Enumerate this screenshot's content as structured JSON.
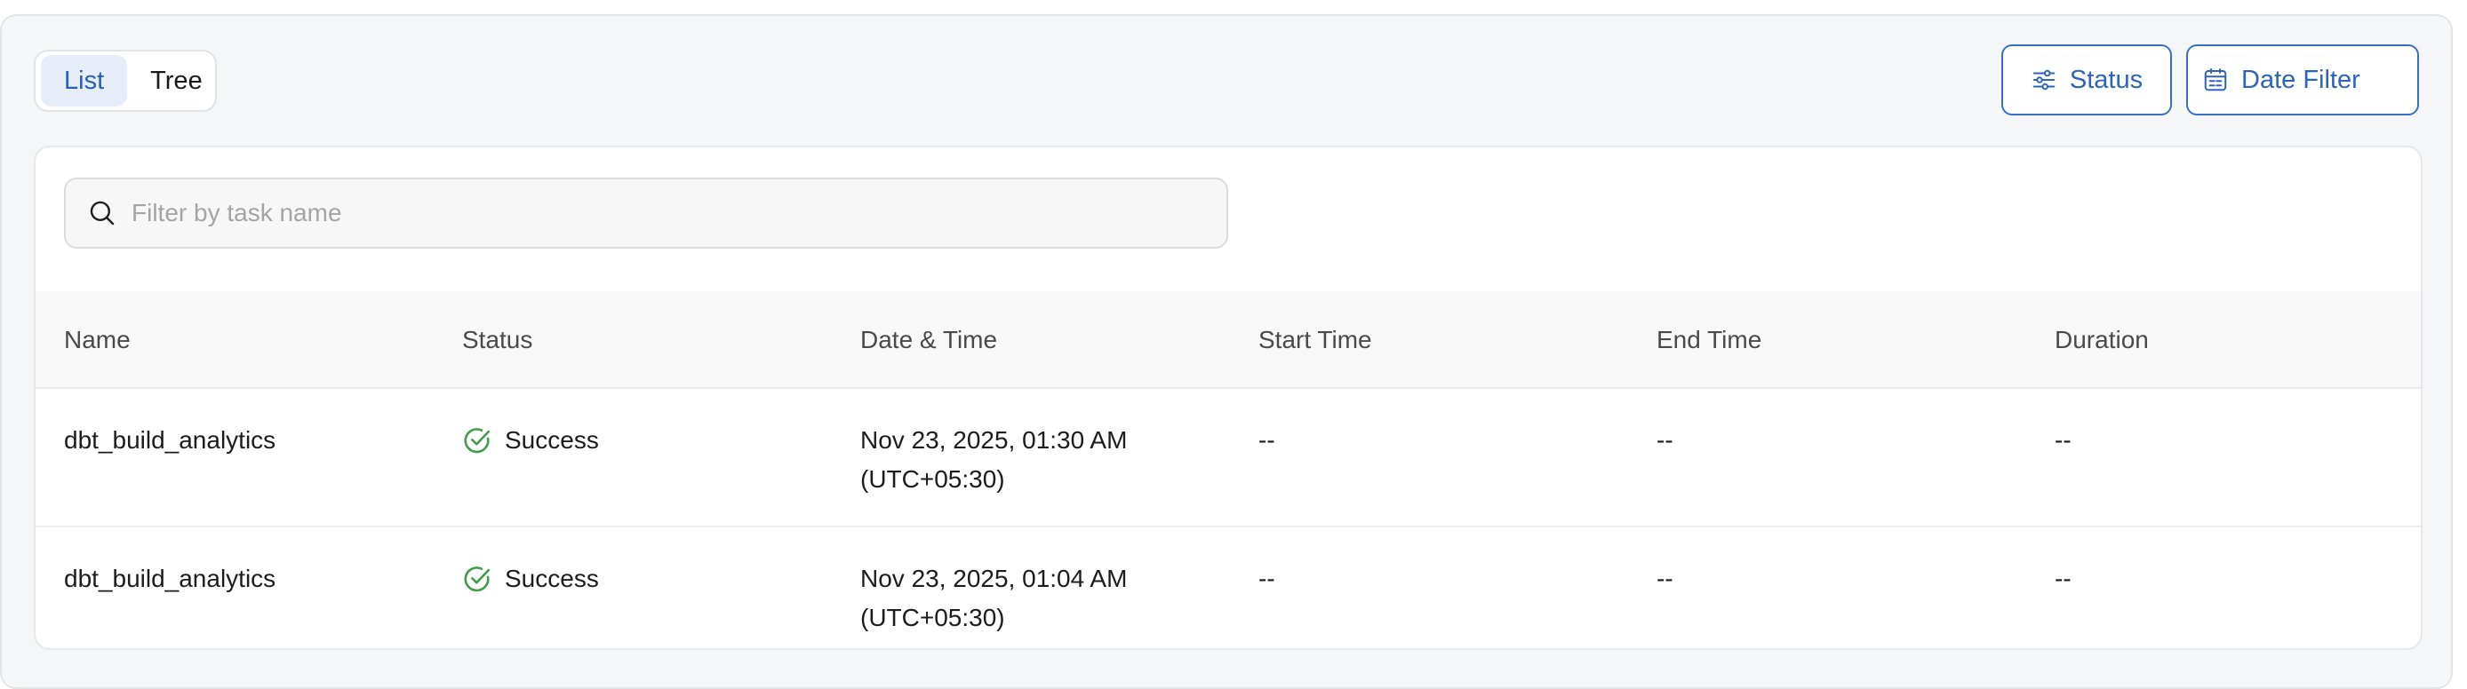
{
  "view_toggle": {
    "list_label": "List",
    "tree_label": "Tree",
    "active": "List"
  },
  "filters": {
    "status_label": "Status",
    "date_label": "Date Filter",
    "accent_color": "#2d63bd"
  },
  "search": {
    "placeholder": "Filter by task name",
    "value": ""
  },
  "table": {
    "columns": [
      "Name",
      "Status",
      "Date & Time",
      "Start Time",
      "End Time",
      "Duration"
    ],
    "rows": [
      {
        "name": "dbt_build_analytics",
        "status": "Success",
        "date_line1": "Nov 23, 2025, 01:30 AM",
        "date_line2": "(UTC+05:30)",
        "start": "--",
        "end": "--",
        "duration": "--"
      },
      {
        "name": "dbt_build_analytics",
        "status": "Success",
        "date_line1": "Nov 23, 2025, 01:04 AM",
        "date_line2": "(UTC+05:30)",
        "start": "--",
        "end": "--",
        "duration": "--"
      }
    ],
    "status_color": "#3f9b4a",
    "icons": {
      "search": "search-icon",
      "status_filter": "sliders-icon",
      "date_filter": "calendar-icon",
      "success": "check-circle-icon"
    }
  }
}
